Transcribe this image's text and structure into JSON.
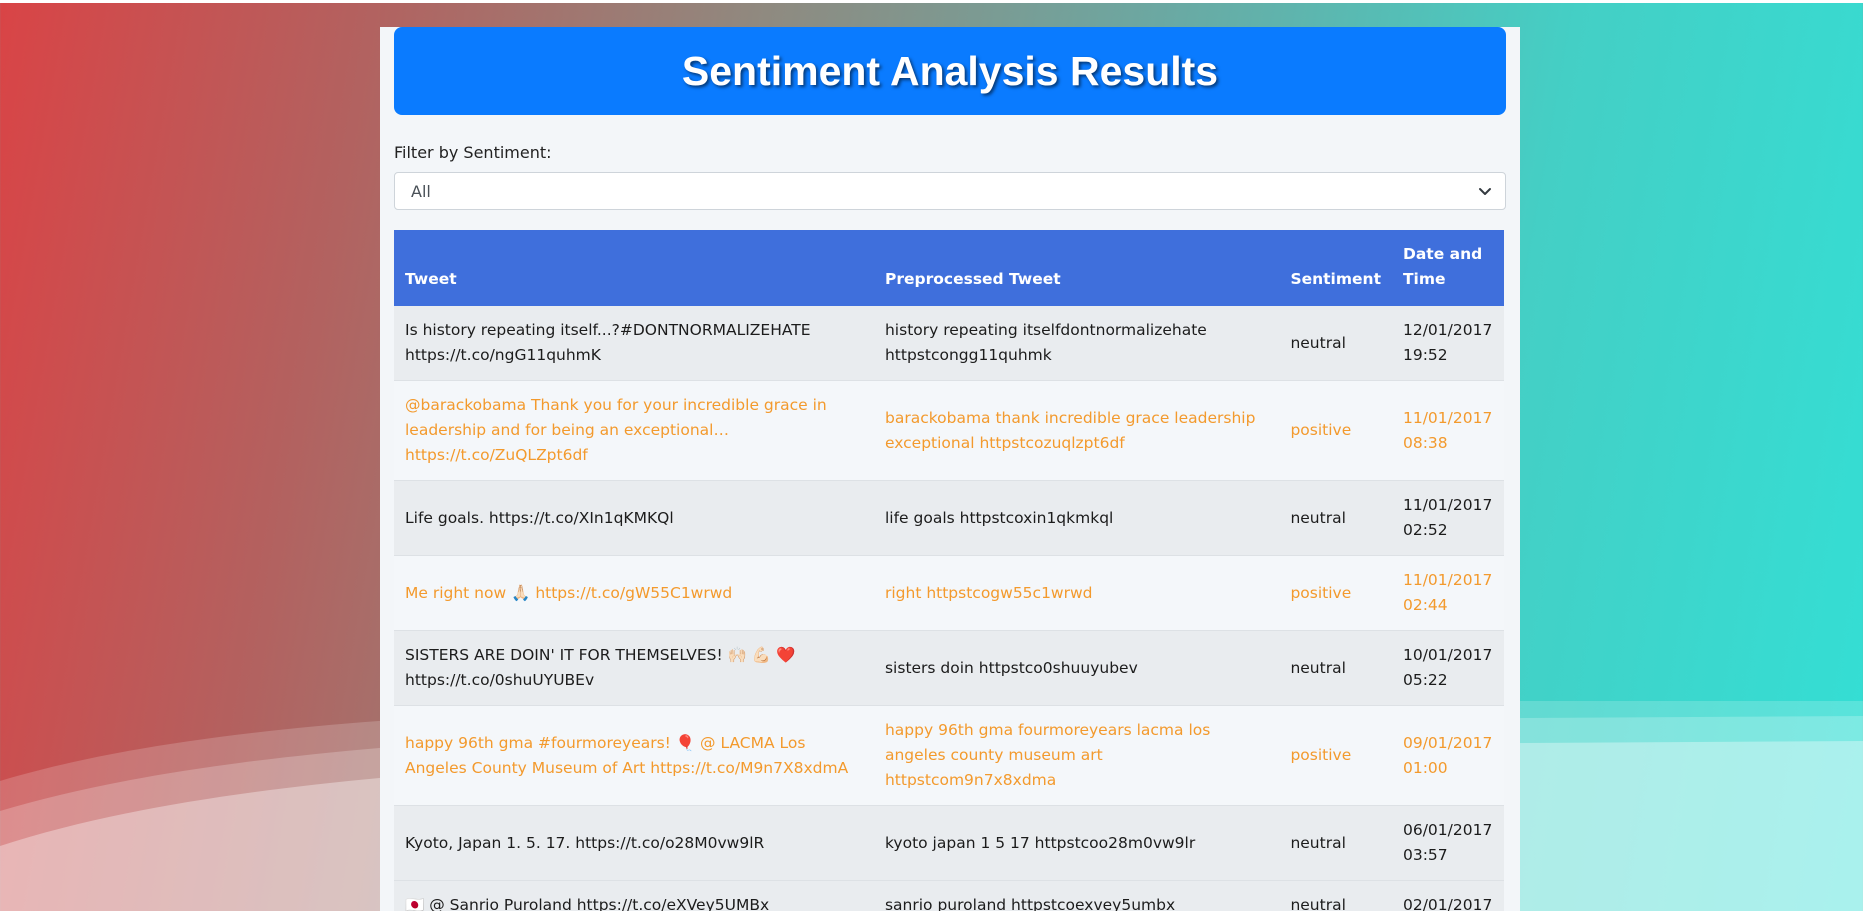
{
  "page": {
    "title": "Sentiment Analysis Results"
  },
  "filter": {
    "label": "Filter by Sentiment:",
    "selected": "All"
  },
  "table": {
    "headers": {
      "tweet": "Tweet",
      "preprocessed": "Preprocessed Tweet",
      "sentiment": "Sentiment",
      "datetime": "Date and Time"
    },
    "rows": [
      {
        "tweet": "Is history repeating itself...?#DONTNORMALIZEHATE https://t.co/ngG11quhmK",
        "preprocessed": "history repeating itselfdontnormalizehate httpstcongg11quhmk",
        "sentiment": "neutral",
        "datetime": "12/01/2017 19:52"
      },
      {
        "tweet": "@barackobama Thank you for your incredible grace in leadership and for being an exceptional… https://t.co/ZuQLZpt6df",
        "preprocessed": "barackobama thank incredible grace leadership exceptional httpstcozuqlzpt6df",
        "sentiment": "positive",
        "datetime": "11/01/2017 08:38"
      },
      {
        "tweet": "Life goals. https://t.co/XIn1qKMKQl",
        "preprocessed": "life goals httpstcoxin1qkmkql",
        "sentiment": "neutral",
        "datetime": "11/01/2017 02:52"
      },
      {
        "tweet": "Me right now 🙏🏻 https://t.co/gW55C1wrwd",
        "preprocessed": "right httpstcogw55c1wrwd",
        "sentiment": "positive",
        "datetime": "11/01/2017 02:44"
      },
      {
        "tweet": "SISTERS ARE DOIN' IT FOR THEMSELVES! 🙌🏻 💪🏻 ❤️ https://t.co/0shuUYUBEv",
        "preprocessed": "sisters doin httpstco0shuuyubev",
        "sentiment": "neutral",
        "datetime": "10/01/2017 05:22"
      },
      {
        "tweet": "happy 96th gma #fourmoreyears! 🎈 @ LACMA Los Angeles County Museum of Art https://t.co/M9n7X8xdmA",
        "preprocessed": "happy 96th gma fourmoreyears lacma los angeles county museum art httpstcom9n7x8xdma",
        "sentiment": "positive",
        "datetime": "09/01/2017 01:00"
      },
      {
        "tweet": "Kyoto, Japan 1. 5. 17. https://t.co/o28M0vw9lR",
        "preprocessed": "kyoto japan 1 5 17 httpstcoo28m0vw9lr",
        "sentiment": "neutral",
        "datetime": "06/01/2017 03:57"
      },
      {
        "tweet": "🇯🇵 @ Sanrio Puroland https://t.co/eXVey5UMBx",
        "preprocessed": "sanrio puroland httpstcoexvey5umbx",
        "sentiment": "neutral",
        "datetime": "02/01/2017"
      }
    ]
  },
  "colors": {
    "header_bg": "#0a7bff",
    "table_header_bg": "#3f6fdc",
    "positive_text": "#f39a2d",
    "neutral_row_bg": "#e9ecef",
    "positive_row_bg": "#f4f7fa"
  },
  "icons": {
    "select_arrow": "chevron-down-icon"
  }
}
